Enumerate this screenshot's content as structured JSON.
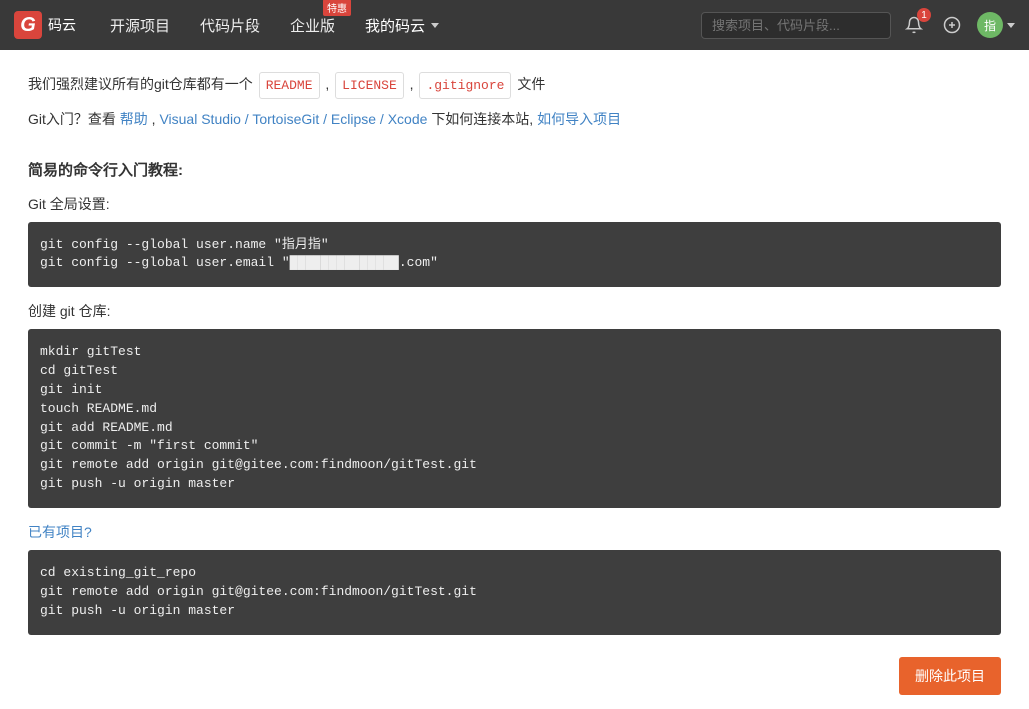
{
  "nav": {
    "logo_text": "码云",
    "items": [
      "开源项目",
      "代码片段",
      "企业版",
      "我的码云"
    ],
    "promo_badge": "特惠",
    "search_placeholder": "搜索项目、代码片段...",
    "notif_count": "1",
    "avatar_text": "指"
  },
  "intro": {
    "prefix": "我们强烈建议所有的git仓库都有一个 ",
    "tags": [
      "README",
      "LICENSE",
      ".gitignore"
    ],
    "suffix": "文件"
  },
  "help": {
    "prefix": "Git入门？查看 ",
    "help_link": "帮助",
    "sep1": " , ",
    "ide_link": "Visual Studio / TortoiseGit / Eclipse / Xcode",
    "mid": " 下如何连接本站, ",
    "import_link": "如何导入项目"
  },
  "tutorial_heading": "简易的命令行入门教程:",
  "global_label": "Git 全局设置:",
  "global_code": "git config --global user.name \"指月指\"\ngit config --global user.email \"██████████████.com\"",
  "create_label": "创建 git 仓库:",
  "create_code": "mkdir gitTest\ncd gitTest\ngit init\ntouch README.md\ngit add README.md\ngit commit -m \"first commit\"\ngit remote add origin git@gitee.com:findmoon/gitTest.git\ngit push -u origin master",
  "existing_label": "已有项目?",
  "existing_code": "cd existing_git_repo\ngit remote add origin git@gitee.com:findmoon/gitTest.git\ngit push -u origin master",
  "delete_btn": "删除此项目"
}
